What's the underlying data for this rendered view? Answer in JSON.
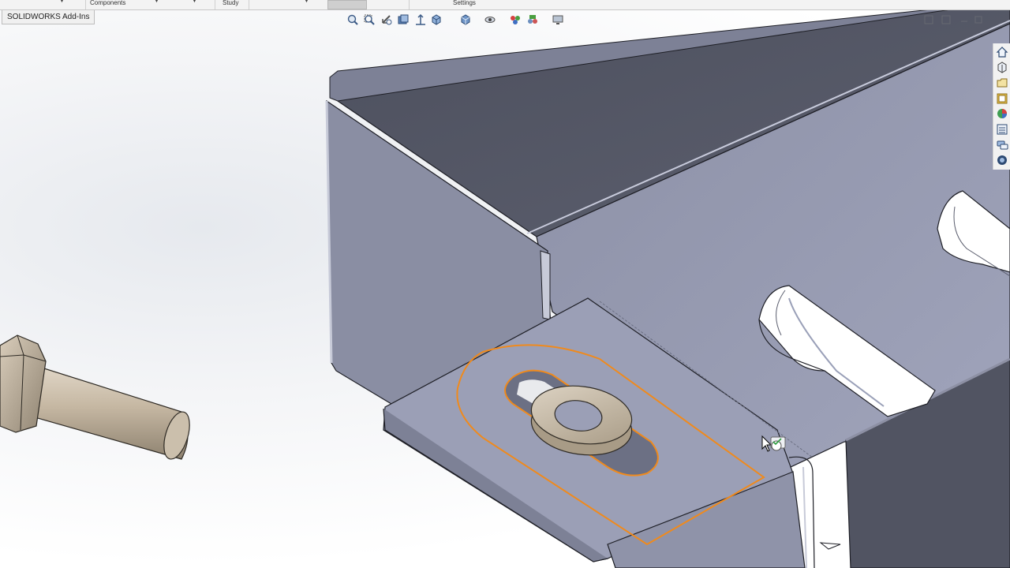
{
  "app": {
    "name": "SOLIDWORKS"
  },
  "ribbon": {
    "items": [
      "Components",
      "Study",
      "Settings"
    ]
  },
  "tabs": {
    "active_label": "SOLIDWORKS Add-Ins"
  },
  "heads_up_toolbar": {
    "icons": [
      "zoom-to-fit-icon",
      "zoom-to-area-icon",
      "previous-view-icon",
      "section-view-icon",
      "view-orientation-icon",
      "display-style-icon",
      "hide-show-items-icon",
      "edit-appearance-icon",
      "apply-scene-icon",
      "view-settings-icon"
    ]
  },
  "task_pane": {
    "icons": [
      "solidworks-resources-icon",
      "design-library-icon",
      "file-explorer-icon",
      "view-palette-icon",
      "appearances-icon",
      "custom-properties-icon",
      "forum-icon",
      "3dexperience-icon"
    ]
  },
  "colors": {
    "highlight": "#f08a1c",
    "sheet_metal_light": "#9a9eb8",
    "sheet_metal_dark": "#5c5f6f",
    "bolt": "#c9bca8"
  }
}
